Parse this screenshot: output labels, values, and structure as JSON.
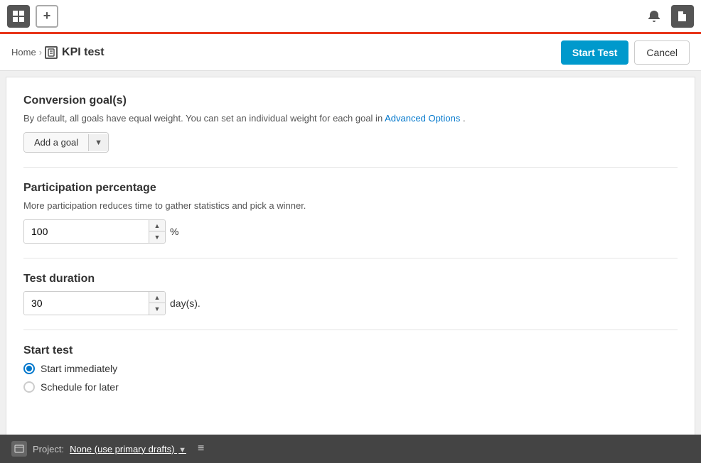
{
  "topbar": {
    "add_icon_title": "Add",
    "notification_icon": "🔔",
    "files_icon": "📁"
  },
  "breadcrumb": {
    "home_label": "Home",
    "separator": "›",
    "current_label": "KPI test"
  },
  "actions": {
    "start_test_label": "Start Test",
    "cancel_label": "Cancel"
  },
  "conversion_goals": {
    "title": "Conversion goal(s)",
    "description": "By default, all goals have equal weight. You can set an individual weight for each goal in",
    "advanced_options_link": "Advanced Options",
    "description_suffix": ".",
    "add_goal_label": "Add a goal"
  },
  "participation": {
    "title": "Participation percentage",
    "description": "More participation reduces time to gather statistics and pick a winner.",
    "value": "100",
    "unit": "%"
  },
  "test_duration": {
    "title": "Test duration",
    "value": "30",
    "unit": "day(s)."
  },
  "start_test": {
    "title": "Start test",
    "options": [
      {
        "id": "immediately",
        "label": "Start immediately",
        "selected": true
      },
      {
        "id": "later",
        "label": "Schedule for later",
        "selected": false
      }
    ]
  },
  "bottom_bar": {
    "project_label": "Project:",
    "project_link": "None (use primary drafts)",
    "menu_icon": "≡"
  }
}
